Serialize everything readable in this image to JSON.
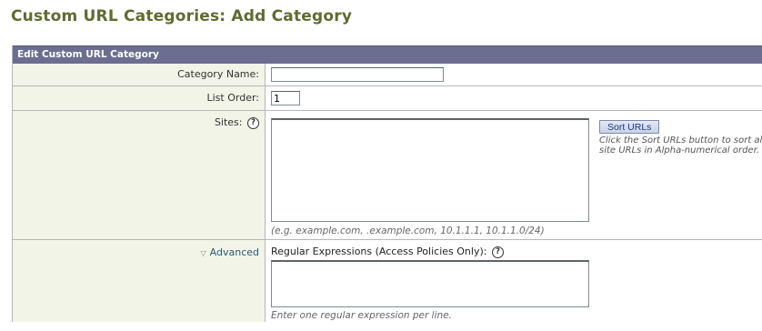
{
  "page": {
    "title": "Custom URL Categories: Add Category"
  },
  "panel": {
    "header": "Edit Custom URL Category"
  },
  "fields": {
    "category_name": {
      "label": "Category Name:",
      "value": ""
    },
    "list_order": {
      "label": "List Order:",
      "value": "1"
    },
    "sites": {
      "label": "Sites:",
      "help_icon": "question-circle-icon",
      "value": "",
      "example": "(e.g. example.com, .example.com, 10.1.1.1, 10.1.1.0/24)",
      "sort_button": "Sort URLs",
      "sort_help": "Click the Sort URLs button to sort all site URLs in Alpha-numerical order."
    },
    "advanced": {
      "link": "Advanced",
      "caret_icon": "triangle-down-icon",
      "regex_label": "Regular Expressions (Access Policies Only):",
      "regex_value": "",
      "regex_help": "Enter one regular expression per line."
    }
  },
  "colors": {
    "title": "#5e6b30",
    "header_bg": "#6b6e90",
    "label_bg": "#f1f4e6",
    "border": "#b7b7b7"
  }
}
